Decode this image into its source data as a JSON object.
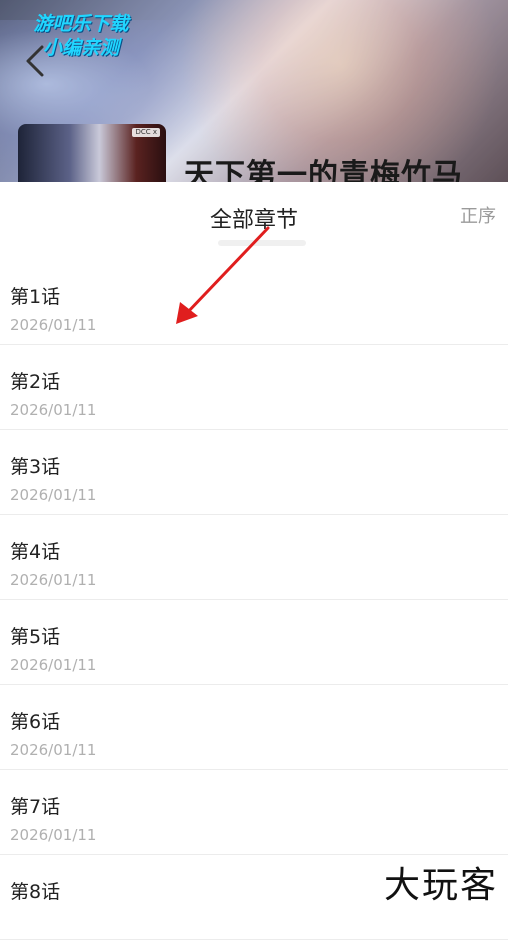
{
  "banner": {
    "watermark_line1": "游吧乐下载",
    "watermark_line2": "小编亲测",
    "cover_logo": "DCC x",
    "title": "天下第一的青梅竹马"
  },
  "sheet": {
    "title": "全部章节",
    "sort_label": "正序"
  },
  "chapters": [
    {
      "name": "第1话",
      "date": "2026/01/11"
    },
    {
      "name": "第2话",
      "date": "2026/01/11"
    },
    {
      "name": "第3话",
      "date": "2026/01/11"
    },
    {
      "name": "第4话",
      "date": "2026/01/11"
    },
    {
      "name": "第5话",
      "date": "2026/01/11"
    },
    {
      "name": "第6话",
      "date": "2026/01/11"
    },
    {
      "name": "第7话",
      "date": "2026/01/11"
    },
    {
      "name": "第8话",
      "date": ""
    }
  ],
  "footer": {
    "watermark": "大玩客"
  },
  "colors": {
    "watermark_cyan": "#20d6ff",
    "annotation_arrow": "#e01e1e",
    "date_gray": "#b0b0b0"
  }
}
